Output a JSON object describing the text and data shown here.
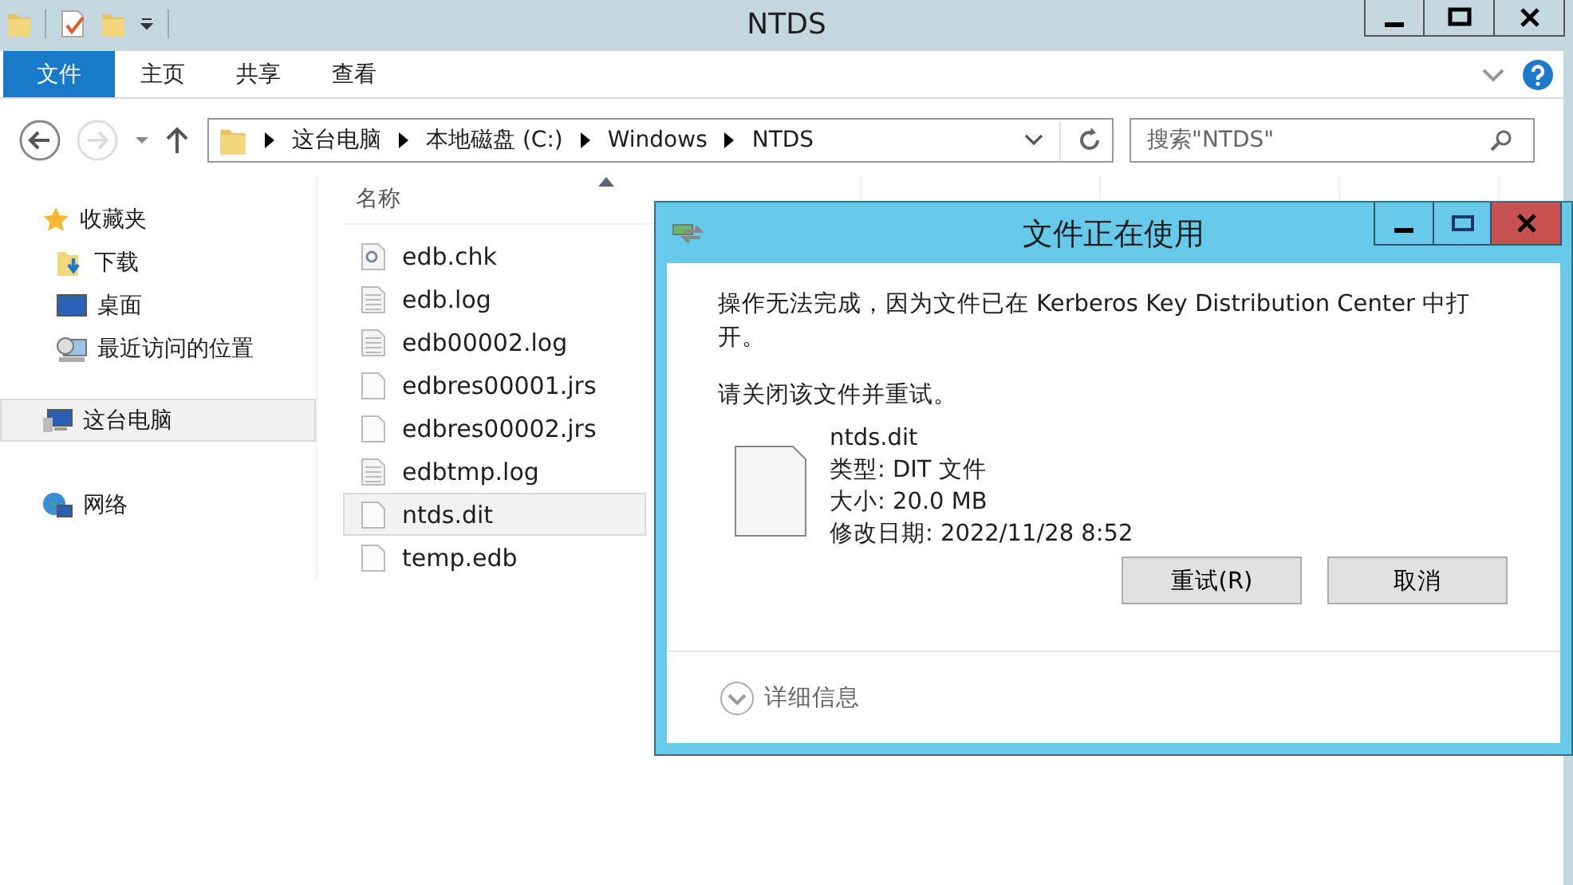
{
  "window": {
    "title": "NTDS"
  },
  "ribbon_tabs": [
    {
      "label": "文件",
      "selected": true
    },
    {
      "label": "主页",
      "selected": false
    },
    {
      "label": "共享",
      "selected": false
    },
    {
      "label": "查看",
      "selected": false
    }
  ],
  "nav": {
    "forward_disabled": true
  },
  "address": {
    "crumbs": [
      "这台电脑",
      "本地磁盘 (C:)",
      "Windows",
      "NTDS"
    ]
  },
  "search": {
    "placeholder": "搜索\"NTDS\""
  },
  "sidebar": {
    "items": [
      {
        "label": "收藏夹",
        "kind": "star",
        "selected": false,
        "children": [
          {
            "label": "下载",
            "kind": "download",
            "selected": false
          },
          {
            "label": "桌面",
            "kind": "desktop",
            "selected": false
          },
          {
            "label": "最近访问的位置",
            "kind": "recent",
            "selected": false
          }
        ]
      },
      {
        "label": "这台电脑",
        "kind": "computer",
        "selected": true
      },
      {
        "label": "网络",
        "kind": "network",
        "selected": false
      }
    ]
  },
  "file_list": {
    "columns": [
      "名称"
    ],
    "files": [
      {
        "name": "edb.chk",
        "kind": "config",
        "selected": false
      },
      {
        "name": "edb.log",
        "kind": "text",
        "selected": false
      },
      {
        "name": "edb00002.log",
        "kind": "text",
        "selected": false
      },
      {
        "name": "edbres00001.jrs",
        "kind": "blank",
        "selected": false
      },
      {
        "name": "edbres00002.jrs",
        "kind": "blank",
        "selected": false
      },
      {
        "name": "edbtmp.log",
        "kind": "text",
        "selected": false
      },
      {
        "name": "ntds.dit",
        "kind": "blank",
        "selected": true
      },
      {
        "name": "temp.edb",
        "kind": "blank",
        "selected": false
      }
    ]
  },
  "dialog": {
    "title": "文件正在使用",
    "message": "操作无法完成，因为文件已在 Kerberos Key Distribution Center 中打开。",
    "instruction": "请关闭该文件并重试。",
    "file": {
      "name": "ntds.dit",
      "type": "类型: DIT 文件",
      "size": "大小: 20.0 MB",
      "modified": "修改日期: 2022/11/28 8:52"
    },
    "buttons": [
      "重试(R)",
      "取消"
    ],
    "details": {
      "label": "详细信息",
      "expanded": false
    }
  }
}
